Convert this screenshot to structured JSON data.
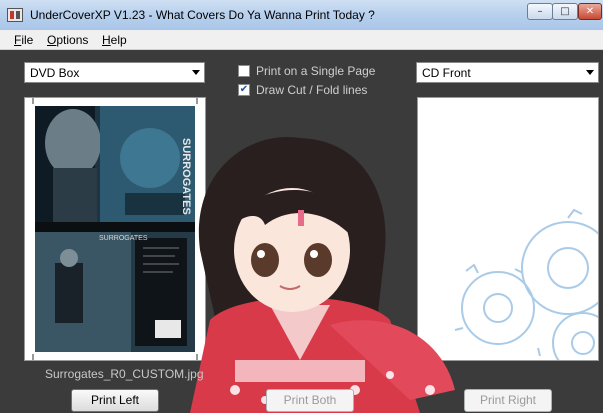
{
  "window": {
    "title": "UnderCoverXP V1.23 - What Covers Do Ya Wanna Print Today ?",
    "controls": {
      "minimize": "–",
      "maximize": "□",
      "close": "✕"
    }
  },
  "menu": [
    {
      "label": "File",
      "accel": "F"
    },
    {
      "label": "Options",
      "accel": "O"
    },
    {
      "label": "Help",
      "accel": "H"
    }
  ],
  "left_combo": {
    "value": "DVD Box"
  },
  "right_combo": {
    "value": "CD Front"
  },
  "options": {
    "single_page": {
      "label": "Print on a Single Page",
      "checked": false
    },
    "cut_fold": {
      "label": "Draw Cut / Fold lines",
      "checked": true
    }
  },
  "left_preview": {
    "filename": "Surrogates_R0_CUSTOM.jpg",
    "spine_text": "SURROGATES",
    "back_title": "SURROGATES"
  },
  "buttons": {
    "print_left": {
      "label": "Print Left",
      "enabled": true
    },
    "print_both": {
      "label": "Print Both",
      "enabled": false
    },
    "print_right": {
      "label": "Print Right",
      "enabled": false
    }
  },
  "colors": {
    "client_background": "#3b3b3b",
    "kimono": "#d83a4a",
    "gear_outline": "#a9cbe8"
  },
  "icons": [
    "app-icon",
    "dropdown-arrow-icon",
    "checkbox-icon",
    "gear-icon"
  ]
}
